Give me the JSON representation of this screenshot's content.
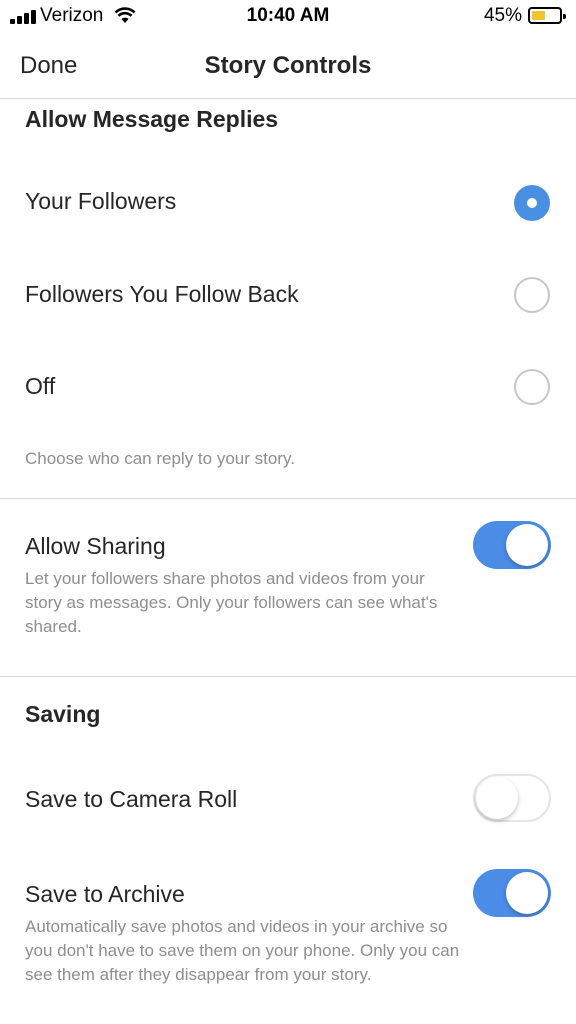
{
  "status_bar": {
    "carrier": "Verizon",
    "time": "10:40 AM",
    "battery_percent": "45%",
    "battery_level": 0.45
  },
  "nav": {
    "done_label": "Done",
    "title": "Story Controls"
  },
  "message_replies": {
    "title": "Allow Message Replies",
    "options": [
      {
        "label": "Your Followers",
        "selected": true
      },
      {
        "label": "Followers You Follow Back",
        "selected": false
      },
      {
        "label": "Off",
        "selected": false
      }
    ],
    "helper": "Choose who can reply to your story."
  },
  "sharing": {
    "label": "Allow Sharing",
    "enabled": true,
    "description": "Let your followers share photos and videos from your story as messages. Only your followers can see what's shared."
  },
  "saving": {
    "title": "Saving",
    "camera_roll": {
      "label": "Save to Camera Roll",
      "enabled": false
    },
    "archive": {
      "label": "Save to Archive",
      "enabled": true,
      "description": "Automatically save photos and videos in your archive so you don't have to save them on your phone. Only you can see them after they disappear from your story."
    }
  },
  "colors": {
    "accent": "#4a8ce6",
    "text": "#262626",
    "secondary_text": "#8e8e8e",
    "battery": "#f2c530"
  }
}
